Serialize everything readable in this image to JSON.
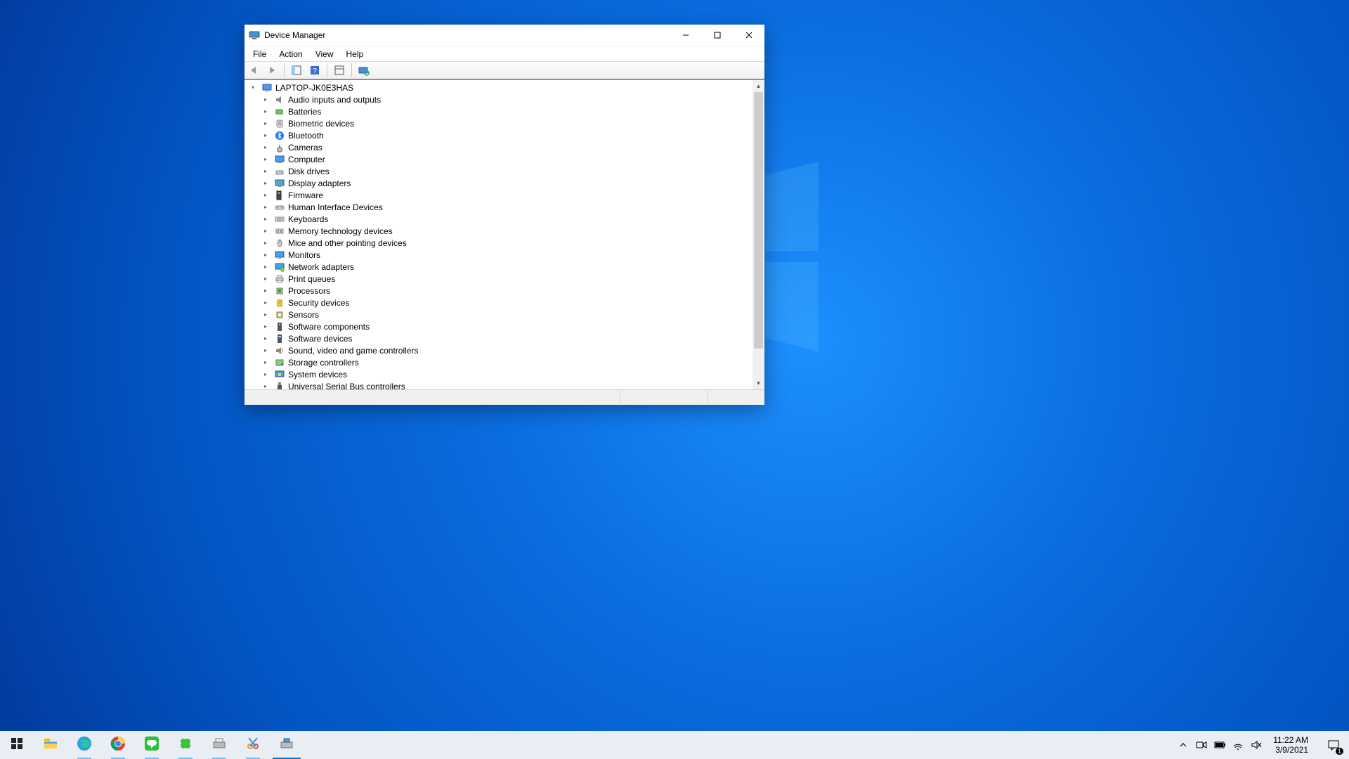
{
  "window": {
    "title": "Device Manager",
    "menus": {
      "file": "File",
      "action": "Action",
      "view": "View",
      "help": "Help"
    }
  },
  "tree": {
    "root": "LAPTOP-JK0E3HAS",
    "categories": [
      {
        "label": "Audio inputs and outputs",
        "icon": "speaker"
      },
      {
        "label": "Batteries",
        "icon": "battery"
      },
      {
        "label": "Biometric devices",
        "icon": "biometric"
      },
      {
        "label": "Bluetooth",
        "icon": "bluetooth"
      },
      {
        "label": "Cameras",
        "icon": "camera"
      },
      {
        "label": "Computer",
        "icon": "computer"
      },
      {
        "label": "Disk drives",
        "icon": "disk"
      },
      {
        "label": "Display adapters",
        "icon": "display"
      },
      {
        "label": "Firmware",
        "icon": "firmware"
      },
      {
        "label": "Human Interface Devices",
        "icon": "hid"
      },
      {
        "label": "Keyboards",
        "icon": "keyboard"
      },
      {
        "label": "Memory technology devices",
        "icon": "memory"
      },
      {
        "label": "Mice and other pointing devices",
        "icon": "mouse"
      },
      {
        "label": "Monitors",
        "icon": "monitor"
      },
      {
        "label": "Network adapters",
        "icon": "network"
      },
      {
        "label": "Print queues",
        "icon": "printer"
      },
      {
        "label": "Processors",
        "icon": "cpu"
      },
      {
        "label": "Security devices",
        "icon": "security"
      },
      {
        "label": "Sensors",
        "icon": "sensor"
      },
      {
        "label": "Software components",
        "icon": "swcomp"
      },
      {
        "label": "Software devices",
        "icon": "swdev"
      },
      {
        "label": "Sound, video and game controllers",
        "icon": "sound"
      },
      {
        "label": "Storage controllers",
        "icon": "storage"
      },
      {
        "label": "System devices",
        "icon": "system"
      },
      {
        "label": "Universal Serial Bus controllers",
        "icon": "usb"
      }
    ]
  },
  "taskbar": {
    "apps": [
      {
        "name": "start",
        "icon": "start"
      },
      {
        "name": "file-explorer",
        "icon": "explorer"
      },
      {
        "name": "edge",
        "icon": "edge",
        "running": true
      },
      {
        "name": "chrome",
        "icon": "chrome",
        "running": true
      },
      {
        "name": "line",
        "icon": "line",
        "running": true
      },
      {
        "name": "clover",
        "icon": "clover",
        "running": true
      },
      {
        "name": "devices-printers",
        "icon": "devprint",
        "running": true
      },
      {
        "name": "snipping-tool",
        "icon": "snip",
        "running": true
      },
      {
        "name": "device-manager",
        "icon": "devmgr",
        "active": true
      }
    ]
  },
  "tray": {
    "time": "11:22 AM",
    "date": "3/9/2021",
    "notification_count": "1"
  }
}
